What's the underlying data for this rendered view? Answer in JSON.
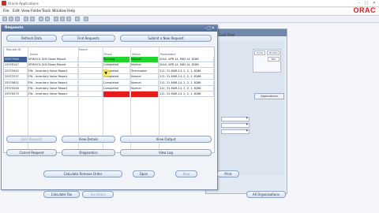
{
  "window": {
    "title": "Oracle Applications"
  },
  "menubar": {
    "items": [
      "File",
      "Edit",
      "View",
      "Folder",
      "Tools",
      "Window",
      "Help"
    ]
  },
  "brand": "ORAC",
  "background_form": {
    "side_label": "Last Time",
    "mini_fields": [
      "Cycle",
      "Months",
      "SBC"
    ],
    "apps_button": "Applications",
    "bottom_button": "All Organizations"
  },
  "requests": {
    "title": "Requests",
    "buttons": {
      "refresh": "Refresh Data",
      "find": "Find Requests",
      "submit": "Submit a New Request",
      "hold": "Hold Request",
      "view_details": "View Details",
      "view_output": "View Output",
      "cancel": "Cancel Request",
      "diagnostics": "Diagnostics",
      "view_log": "View Log"
    },
    "columns": {
      "request_id": "Request ID",
      "parent": "Parent",
      "name": "Name",
      "phase": "Phase",
      "status": "Status",
      "parameters": "Parameters"
    },
    "rows": [
      {
        "id": "25577563",
        "name": "SFM/UOL Drill Down Report",
        "phase": "Running",
        "status": "Normal",
        "params": "2044, APR-14, MAY-14, 8286"
      },
      {
        "id": "25576147",
        "name": "SFM/UOL Drill Down Report",
        "phase": "Completed",
        "status": "Normal",
        "params": "2044, APR-14, MAY-14, 8286"
      },
      {
        "id": "25572942",
        "name": "FW - Inventory Value Report",
        "phase": "Completed",
        "status": "Terminated",
        "params": "111, 31-MAR-14, 2, 2, 1, 8286"
      },
      {
        "id": "25572237",
        "name": "FW - Inventory Value Report",
        "phase": "Completed",
        "status": "Normal",
        "params": "111, 31-MAR-14, 2, 2, 1, 8286"
      },
      {
        "id": "25570652",
        "name": "FW - Inventory Value Report",
        "phase": "Completed",
        "status": "Normal",
        "params": "111, 31-MAR-14, 2, 2, 1, 8286"
      },
      {
        "id": "25570046",
        "name": "FW - Inventory Value Report",
        "phase": "Completed",
        "status": "Normal",
        "params": "111, 31-MAR-14, 2, 2, 1, 8286"
      },
      {
        "id": "25570075",
        "name": "FW - Inventory Value Report",
        "phase": "Completed",
        "status": "Error",
        "params": "111, 31-MAR-14, 2, 2, 1, 8286"
      }
    ],
    "colors": {
      "running": "#21d62a",
      "normal_running": "#21d62a",
      "error": "#e61b1b",
      "selected": "#3f5f95"
    }
  },
  "bottom_buttons": {
    "calculate_remove": "Calculate Remove Order",
    "open": "Open",
    "new": "New",
    "print": "Print",
    "calculate_tax": "Calculate Tax",
    "tax_detail": "Tax Detail"
  }
}
